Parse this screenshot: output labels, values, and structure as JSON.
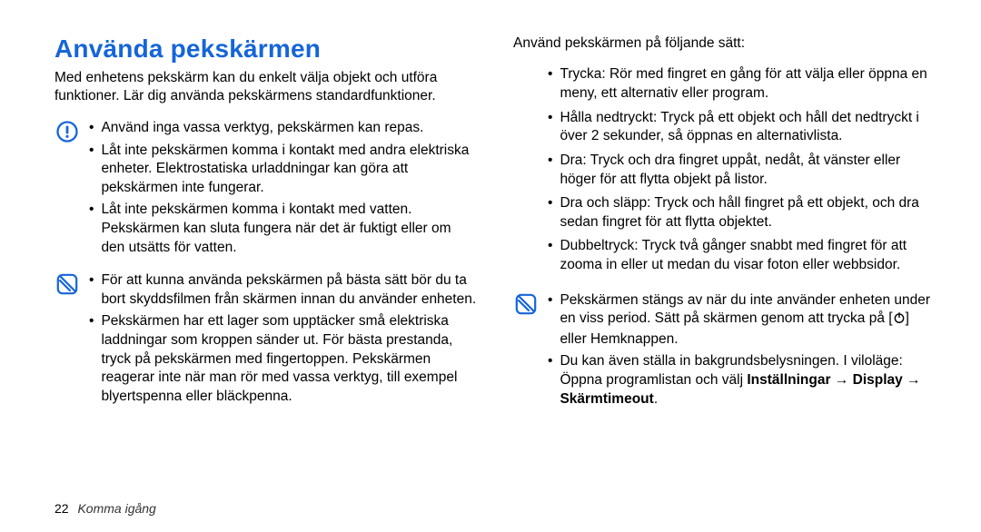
{
  "heading": "Använda pekskärmen",
  "intro": "Med enhetens pekskärm kan du enkelt välja objekt och utföra funktioner. Lär dig använda pekskärmens standardfunktioner.",
  "warn": [
    "Använd inga vassa verktyg, pekskärmen kan repas.",
    "Låt inte pekskärmen komma i kontakt med andra elektriska enheter. Elektrostatiska urladdningar kan göra att pekskärmen inte fungerar.",
    "Låt inte pekskärmen komma i kontakt med vatten. Pekskärmen kan sluta fungera när det är fuktigt eller om den utsätts för vatten."
  ],
  "tips": [
    "För att kunna använda pekskärmen på bästa sätt bör du ta bort skyddsfilmen från skärmen innan du använder enheten.",
    "Pekskärmen har ett lager som upptäcker små elektriska laddningar som kroppen sänder ut. För bästa prestanda, tryck på pekskärmen med fingertoppen. Pekskärmen reagerar inte när man rör med vassa verktyg, till exempel blyertspenna eller bläckpenna."
  ],
  "usage_lead": "Använd pekskärmen på följande sätt:",
  "usage": [
    "Trycka: Rör med fingret en gång för att välja eller öppna en meny, ett alternativ eller program.",
    "Hålla nedtryckt: Tryck på ett objekt och håll det nedtryckt i över 2 sekunder, så öppnas en alternativlista.",
    "Dra: Tryck och dra fingret uppåt, nedåt, åt vänster eller höger för att flytta objekt på listor.",
    "Dra och släpp: Tryck och håll fingret på ett objekt, och dra sedan fingret för att flytta objektet.",
    "Dubbeltryck: Tryck två gånger snabbt med fingret för att zooma in eller ut medan du visar foton eller webbsidor."
  ],
  "notes": {
    "item0_pre": "Pekskärmen stängs av när du inte använder enheten under en viss period. Sätt på skärmen genom att trycka på [",
    "item0_post": "] eller Hemknappen.",
    "item1_pre": "Du kan även ställa in bakgrundsbelysningen. I viloläge: Öppna programlistan och välj ",
    "item1_b1": "Inställningar",
    "item1_arrow": " → ",
    "item1_b2": "Display",
    "item1_b3": "Skärmtimeout",
    "item1_period": "."
  },
  "footer": {
    "page": "22",
    "section": "Komma igång"
  }
}
